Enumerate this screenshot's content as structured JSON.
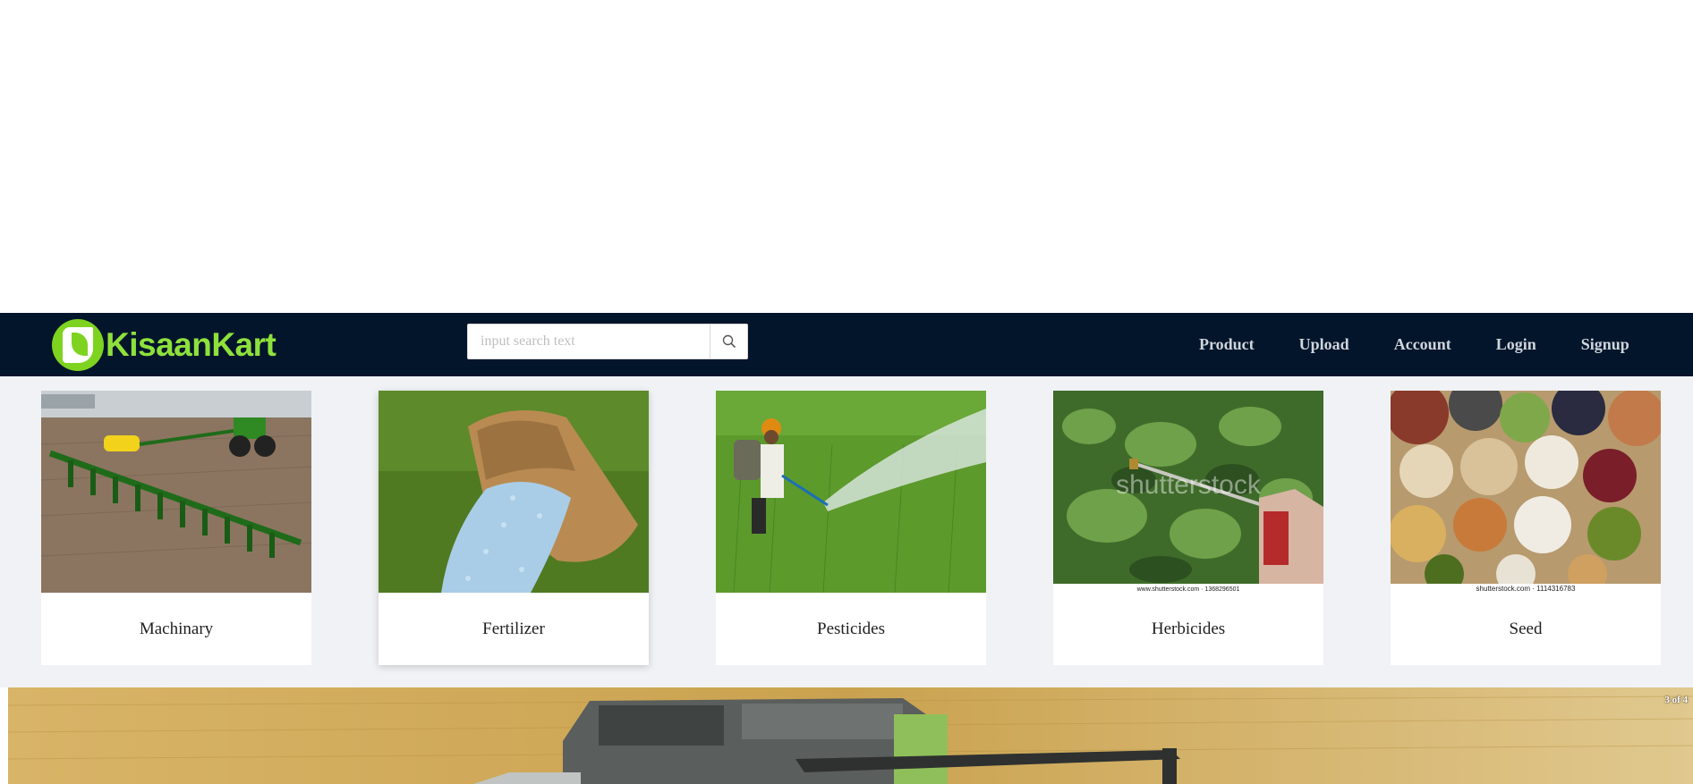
{
  "brand": {
    "name": "KisaanKart"
  },
  "search": {
    "placeholder": "input search text",
    "icon": "search-icon"
  },
  "nav": {
    "items": [
      {
        "label": "Product"
      },
      {
        "label": "Upload"
      },
      {
        "label": "Account"
      },
      {
        "label": "Login"
      },
      {
        "label": "Signup"
      }
    ]
  },
  "categories": [
    {
      "label": "Machinary",
      "image": "planter-tractor-photo"
    },
    {
      "label": "Fertilizer",
      "image": "fertilizer-sack-photo"
    },
    {
      "label": "Pesticides",
      "image": "farmer-spraying-photo"
    },
    {
      "label": "Herbicides",
      "image": "herbicide-spray-photo",
      "watermark": "shutterstock",
      "caption": "www.shutterstock.com · 1368296501"
    },
    {
      "label": "Seed",
      "image": "seed-assortment-photo",
      "caption": "shutterstock.com · 1114316783"
    }
  ],
  "banner": {
    "counter": "3 of 4",
    "image": "combine-harvester-photo"
  },
  "colors": {
    "navbar": "#02152b",
    "brand_green": "#8ee13b",
    "section_bg": "#f0f2f5"
  }
}
